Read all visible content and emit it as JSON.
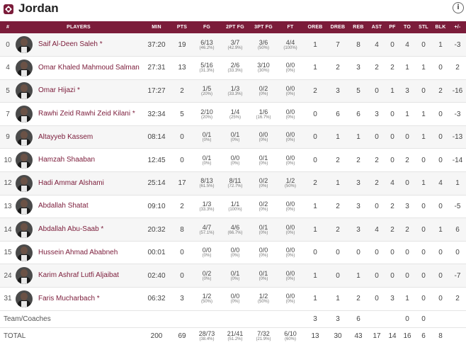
{
  "team": {
    "name": "Jordan"
  },
  "columns": [
    "#",
    "PLAYERS",
    "MIN",
    "PTS",
    "FG",
    "2PT FG",
    "3PT FG",
    "FT",
    "OREB",
    "DREB",
    "REB",
    "AST",
    "PF",
    "TO",
    "STL",
    "BLK",
    "+/-",
    "EFF"
  ],
  "players": [
    {
      "num": "0",
      "name": "Saif Al-Deen Saleh *",
      "min": "37:20",
      "pts": "19",
      "fg": [
        "6/13",
        "(46.2%)"
      ],
      "fg2": [
        "3/7",
        "(42.9%)"
      ],
      "fg3": [
        "3/6",
        "(50%)"
      ],
      "ft": [
        "4/4",
        "(100%)"
      ],
      "oreb": "1",
      "dreb": "7",
      "reb": "8",
      "ast": "4",
      "pf": "0",
      "to": "4",
      "stl": "0",
      "blk": "1",
      "pm": "-3",
      "eff": "21"
    },
    {
      "num": "4",
      "name": "Omar Khaled Mahmoud Salman",
      "min": "27:31",
      "pts": "13",
      "fg": [
        "5/16",
        "(31.3%)"
      ],
      "fg2": [
        "2/6",
        "(33.3%)"
      ],
      "fg3": [
        "3/10",
        "(30%)"
      ],
      "ft": [
        "0/0",
        "(0%)"
      ],
      "oreb": "1",
      "dreb": "2",
      "reb": "3",
      "ast": "2",
      "pf": "2",
      "to": "1",
      "stl": "1",
      "blk": "0",
      "pm": "2",
      "eff": "7"
    },
    {
      "num": "5",
      "name": "Omar Hijazi *",
      "min": "17:27",
      "pts": "2",
      "fg": [
        "1/5",
        "(20%)"
      ],
      "fg2": [
        "1/3",
        "(33.3%)"
      ],
      "fg3": [
        "0/2",
        "(0%)"
      ],
      "ft": [
        "0/0",
        "(0%)"
      ],
      "oreb": "2",
      "dreb": "3",
      "reb": "5",
      "ast": "0",
      "pf": "1",
      "to": "3",
      "stl": "0",
      "blk": "2",
      "pm": "-16",
      "eff": "2"
    },
    {
      "num": "7",
      "name": "Rawhi Zeid Rawhi Zeid Kilani *",
      "min": "32:34",
      "pts": "5",
      "fg": [
        "2/10",
        "(20%)"
      ],
      "fg2": [
        "1/4",
        "(25%)"
      ],
      "fg3": [
        "1/6",
        "(16.7%)"
      ],
      "ft": [
        "0/0",
        "(0%)"
      ],
      "oreb": "0",
      "dreb": "6",
      "reb": "6",
      "ast": "3",
      "pf": "0",
      "to": "1",
      "stl": "1",
      "blk": "0",
      "pm": "-3",
      "eff": "6"
    },
    {
      "num": "9",
      "name": "Altayyeb Kassem",
      "min": "08:14",
      "pts": "0",
      "fg": [
        "0/1",
        "(0%)"
      ],
      "fg2": [
        "0/1",
        "(0%)"
      ],
      "fg3": [
        "0/0",
        "(0%)"
      ],
      "ft": [
        "0/0",
        "(0%)"
      ],
      "oreb": "0",
      "dreb": "1",
      "reb": "1",
      "ast": "0",
      "pf": "0",
      "to": "0",
      "stl": "1",
      "blk": "0",
      "pm": "-13",
      "eff": "1"
    },
    {
      "num": "10",
      "name": "Hamzah Shaaban",
      "min": "12:45",
      "pts": "0",
      "fg": [
        "0/1",
        "(0%)"
      ],
      "fg2": [
        "0/0",
        "(0%)"
      ],
      "fg3": [
        "0/1",
        "(0%)"
      ],
      "ft": [
        "0/0",
        "(0%)"
      ],
      "oreb": "0",
      "dreb": "2",
      "reb": "2",
      "ast": "2",
      "pf": "0",
      "to": "2",
      "stl": "0",
      "blk": "0",
      "pm": "-14",
      "eff": "1"
    },
    {
      "num": "12",
      "name": "Hadi Ammar Alshami",
      "min": "25:14",
      "pts": "17",
      "fg": [
        "8/13",
        "(61.5%)"
      ],
      "fg2": [
        "8/11",
        "(72.7%)"
      ],
      "fg3": [
        "0/2",
        "(0%)"
      ],
      "ft": [
        "1/2",
        "(50%)"
      ],
      "oreb": "2",
      "dreb": "1",
      "reb": "3",
      "ast": "2",
      "pf": "4",
      "to": "0",
      "stl": "1",
      "blk": "4",
      "pm": "1",
      "eff": "21"
    },
    {
      "num": "13",
      "name": "Abdallah Shatat",
      "min": "09:10",
      "pts": "2",
      "fg": [
        "1/3",
        "(33.3%)"
      ],
      "fg2": [
        "1/1",
        "(100%)"
      ],
      "fg3": [
        "0/2",
        "(0%)"
      ],
      "ft": [
        "0/0",
        "(0%)"
      ],
      "oreb": "1",
      "dreb": "2",
      "reb": "3",
      "ast": "0",
      "pf": "2",
      "to": "3",
      "stl": "0",
      "blk": "0",
      "pm": "-5",
      "eff": "-2"
    },
    {
      "num": "14",
      "name": "Abdallah Abu-Saab *",
      "min": "20:32",
      "pts": "8",
      "fg": [
        "4/7",
        "(57.1%)"
      ],
      "fg2": [
        "4/6",
        "(66.7%)"
      ],
      "fg3": [
        "0/1",
        "(0%)"
      ],
      "ft": [
        "0/0",
        "(0%)"
      ],
      "oreb": "1",
      "dreb": "2",
      "reb": "3",
      "ast": "4",
      "pf": "2",
      "to": "2",
      "stl": "0",
      "blk": "1",
      "pm": "6",
      "eff": "15"
    },
    {
      "num": "15",
      "name": "Hussein Ahmad Ababneh",
      "min": "00:01",
      "pts": "0",
      "fg": [
        "0/0",
        "(0%)"
      ],
      "fg2": [
        "0/0",
        "(0%)"
      ],
      "fg3": [
        "0/0",
        "(0%)"
      ],
      "ft": [
        "0/0",
        "(0%)"
      ],
      "oreb": "0",
      "dreb": "0",
      "reb": "0",
      "ast": "0",
      "pf": "0",
      "to": "0",
      "stl": "0",
      "blk": "0",
      "pm": "0",
      "eff": "-1"
    },
    {
      "num": "24",
      "name": "Karim Ashraf Lutfi Aljaibat",
      "min": "02:40",
      "pts": "0",
      "fg": [
        "0/2",
        "(0%)"
      ],
      "fg2": [
        "0/1",
        "(0%)"
      ],
      "fg3": [
        "0/1",
        "(0%)"
      ],
      "ft": [
        "0/0",
        "(0%)"
      ],
      "oreb": "1",
      "dreb": "0",
      "reb": "1",
      "ast": "0",
      "pf": "0",
      "to": "0",
      "stl": "0",
      "blk": "0",
      "pm": "-7",
      "eff": "-1"
    },
    {
      "num": "31",
      "name": "Faris Mucharbach *",
      "min": "06:32",
      "pts": "3",
      "fg": [
        "1/2",
        "(50%)"
      ],
      "fg2": [
        "0/0",
        "(0%)"
      ],
      "fg3": [
        "1/2",
        "(50%)"
      ],
      "ft": [
        "0/0",
        "(0%)"
      ],
      "oreb": "1",
      "dreb": "1",
      "reb": "2",
      "ast": "0",
      "pf": "3",
      "to": "1",
      "stl": "0",
      "blk": "0",
      "pm": "2",
      "eff": "2"
    }
  ],
  "team_row": {
    "label": "Team/Coaches",
    "oreb": "3",
    "dreb": "3",
    "reb": "6",
    "ast": "",
    "pf": "",
    "to": "0",
    "stl": "0",
    "blk": "",
    "pm": "",
    "eff": "72"
  },
  "total_row": {
    "label": "TOTAL",
    "min": "200",
    "pts": "69",
    "fg": [
      "28/73",
      "(38.4%)"
    ],
    "fg2": [
      "21/41",
      "(51.2%)"
    ],
    "fg3": [
      "7/32",
      "(21.9%)"
    ],
    "ft": [
      "6/10",
      "(60%)"
    ],
    "oreb": "13",
    "dreb": "30",
    "reb": "43",
    "ast": "17",
    "pf": "14",
    "to": "16",
    "stl": "6",
    "blk": "8",
    "pm": "",
    "eff": "72"
  },
  "colors": {
    "accent": "#7b1c3a",
    "row_alt": "#f6f6f6"
  }
}
